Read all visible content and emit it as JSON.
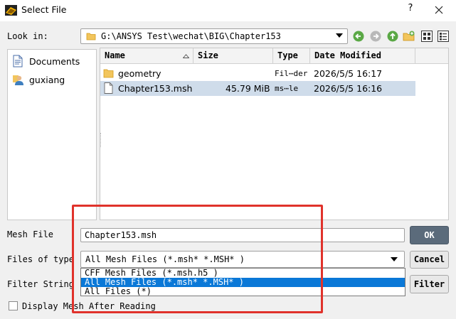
{
  "window": {
    "title": "Select File",
    "help": "?"
  },
  "lookin": {
    "label": "Look in:",
    "path": "G:\\ANSYS Test\\wechat\\BIG\\Chapter153"
  },
  "toolbar": [
    "back-icon",
    "forward-icon",
    "up-folder-icon",
    "new-folder-icon",
    "list-view-icon",
    "detail-view-icon"
  ],
  "places": [
    {
      "label": "Documents",
      "icon": "document-icon"
    },
    {
      "label": "guxiang",
      "icon": "user-icon"
    }
  ],
  "columns": {
    "name": "Name",
    "size": "Size",
    "type": "Type",
    "date": "Date Modified"
  },
  "files": [
    {
      "name": "geometry",
      "size": "",
      "type": "Fil⋯der",
      "date": "2026/5/5 16:17",
      "icon": "folder-icon"
    },
    {
      "name": "Chapter153.msh",
      "size": "45.79 MiB",
      "type": "ms⋯le",
      "date": "2026/5/5 16:16",
      "icon": "file-icon"
    }
  ],
  "mesh_file": {
    "label": "Mesh File",
    "value": "Chapter153.msh"
  },
  "files_of_type": {
    "label": "Files of type",
    "value": "All Mesh Files (*.msh* *.MSH* )",
    "options": [
      "CFF Mesh Files (*.msh.h5 )",
      "All Mesh Files (*.msh* *.MSH* )",
      "All Files (*)"
    ]
  },
  "filter_string": {
    "label": "Filter String"
  },
  "buttons": {
    "ok": "OK",
    "cancel": "Cancel",
    "filter": "Filter"
  },
  "display_mesh": {
    "label": "Display Mesh After Reading",
    "checked": false
  },
  "colors": {
    "selection": "#0a78d7",
    "highlight_box": "#e0322b",
    "row_selected": "#cfdcea"
  }
}
